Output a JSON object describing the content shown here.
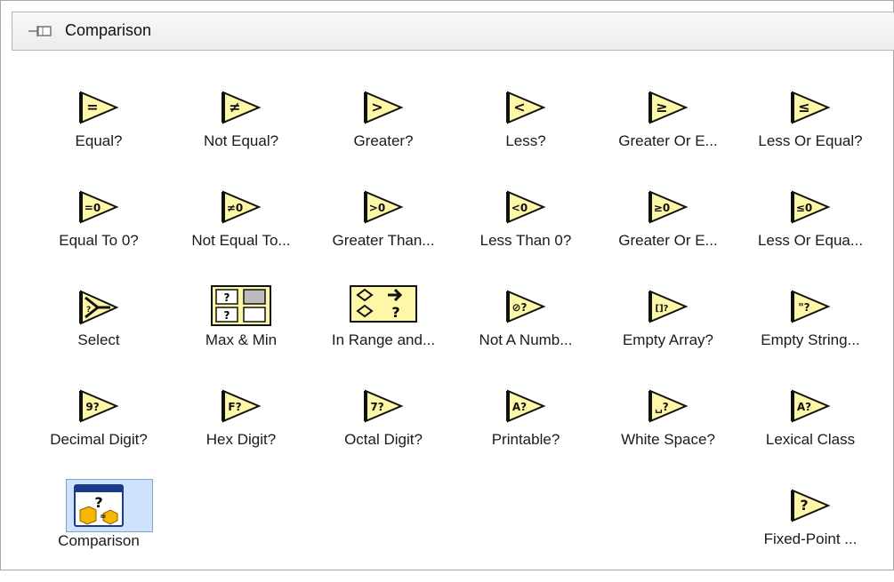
{
  "palette": {
    "title": "Comparison",
    "items": [
      {
        "label": "Equal?",
        "icon": "equal-icon",
        "sym": "="
      },
      {
        "label": "Not Equal?",
        "icon": "not-equal-icon",
        "sym": "≠"
      },
      {
        "label": "Greater?",
        "icon": "greater-icon",
        "sym": ">"
      },
      {
        "label": "Less?",
        "icon": "less-icon",
        "sym": "<"
      },
      {
        "label": "Greater Or E...",
        "icon": "greater-or-equal-icon",
        "sym": "≥"
      },
      {
        "label": "Less Or Equal?",
        "icon": "less-or-equal-icon",
        "sym": "≤"
      },
      {
        "label": "Equal To 0?",
        "icon": "equal-to-zero-icon",
        "sym": "=0"
      },
      {
        "label": "Not Equal To...",
        "icon": "not-equal-to-zero-icon",
        "sym": "≠0"
      },
      {
        "label": "Greater Than...",
        "icon": "greater-than-zero-icon",
        "sym": ">0"
      },
      {
        "label": "Less Than 0?",
        "icon": "less-than-zero-icon",
        "sym": "<0"
      },
      {
        "label": "Greater Or E...",
        "icon": "greater-or-equal-zero-icon",
        "sym": "≥0"
      },
      {
        "label": "Less Or Equa...",
        "icon": "less-or-equal-zero-icon",
        "sym": "≤0"
      },
      {
        "label": "Select",
        "icon": "select-icon",
        "sym": "?"
      },
      {
        "label": "Max & Min",
        "icon": "max-min-icon",
        "sym": "?"
      },
      {
        "label": "In Range and...",
        "icon": "in-range-coerce-icon",
        "sym": "?"
      },
      {
        "label": "Not A Numb...",
        "icon": "not-a-number-icon",
        "sym": "⊘?"
      },
      {
        "label": "Empty Array?",
        "icon": "empty-array-icon",
        "sym": "[]?"
      },
      {
        "label": "Empty String...",
        "icon": "empty-string-icon",
        "sym": "\"?"
      },
      {
        "label": "Decimal Digit?",
        "icon": "decimal-digit-icon",
        "sym": "9?"
      },
      {
        "label": "Hex Digit?",
        "icon": "hex-digit-icon",
        "sym": "F?"
      },
      {
        "label": "Octal Digit?",
        "icon": "octal-digit-icon",
        "sym": "7?"
      },
      {
        "label": "Printable?",
        "icon": "printable-icon",
        "sym": "A?"
      },
      {
        "label": "White Space?",
        "icon": "white-space-icon",
        "sym": "␣?"
      },
      {
        "label": "Lexical Class",
        "icon": "lexical-class-icon",
        "sym": "A?"
      },
      {
        "label": "Comparison",
        "icon": "comparison-express-icon",
        "sym": "?"
      },
      {
        "label": "Fixed-Point ...",
        "icon": "fixed-point-overflow-icon",
        "sym": "?"
      }
    ]
  },
  "colors": {
    "icon_fill": "#fff7a8",
    "icon_stroke": "#111111",
    "selected_bg": "#cfe2fb",
    "selected_border": "#7da2ce"
  }
}
